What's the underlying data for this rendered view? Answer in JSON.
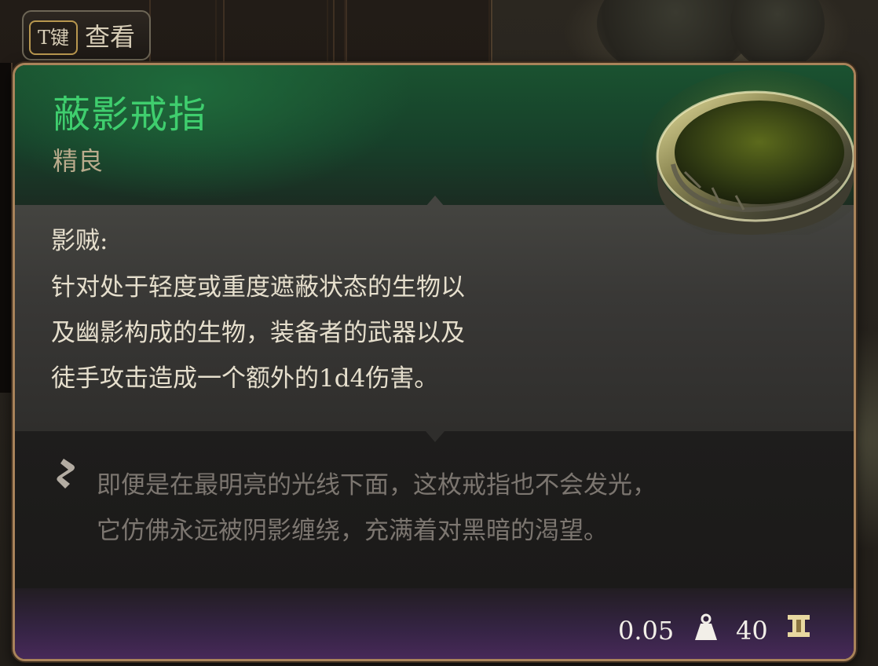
{
  "key_hint": {
    "key": "T键",
    "label": "查看"
  },
  "item": {
    "name": "蔽影戒指",
    "rarity": "精良",
    "ability": {
      "name": "影贼:",
      "description_lines": [
        "针对处于轻度或重度遮蔽状态的生物以",
        "及幽影构成的生物，装备者的武器以及",
        "徒手攻击造成一个额外的1d4伤害。"
      ]
    },
    "flavor_lines": [
      "即便是在最明亮的光线下面，这枚戒指也不会发光，",
      "它仿佛永远被阴影缠绕，充满着对黑暗的渴望。"
    ],
    "weight": "0.05",
    "value": "40"
  },
  "icons": {
    "flavor": "quill-icon",
    "weight": "weight-icon",
    "value": "gold-coin-icon",
    "artwork": "ring-icon"
  },
  "colors": {
    "rarity_uncommon": "#3fce6e",
    "border_gold": "#a9835a",
    "flavor_text": "#7c7670",
    "footer_purple": "#4a2a5c"
  }
}
